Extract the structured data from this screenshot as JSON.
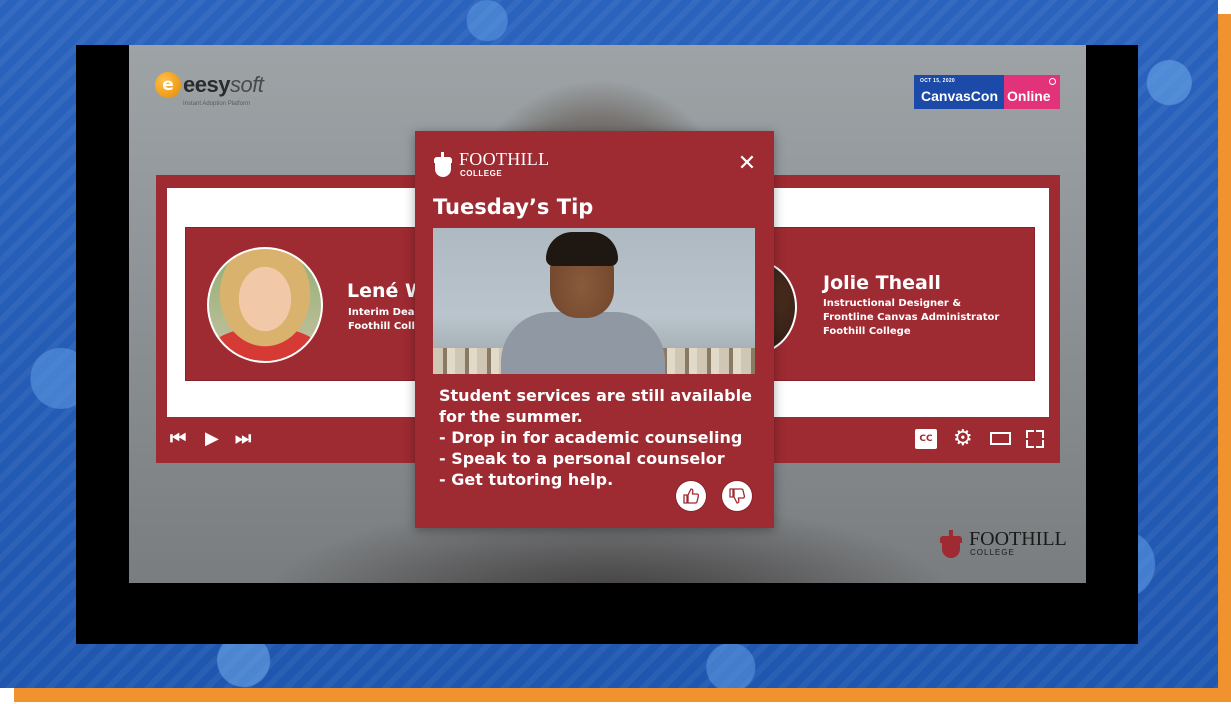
{
  "frame": {
    "accent_color": "#f0922e",
    "background_color": "#1f57b0"
  },
  "brand_top_left": {
    "badge": "e",
    "name_bold": "eesy",
    "name_light": "soft",
    "tagline": "Instant Adoption Platform"
  },
  "event_badge": {
    "date": "OCT 15, 2020",
    "name": "CanvasCon",
    "online": "Online",
    "colors": {
      "left": "#1b4aa8",
      "right": "#e2337a"
    }
  },
  "player": {
    "accent_color": "#9e2a32",
    "speaker_left": {
      "name": "Lené W",
      "role_lines": [
        "Interim Dea",
        "Foothill Coll"
      ]
    },
    "speaker_right": {
      "name": "Jolie Theall",
      "role_lines": [
        "Instructional Designer &",
        "Frontline Canvas Administrator",
        "Foothill College"
      ]
    },
    "controls": {
      "prev": "⏮",
      "play": "▶",
      "next": "⏭",
      "cc": "CC",
      "settings": "⚙"
    }
  },
  "tip": {
    "brand": "FOOTHILL",
    "brand_sub": "COLLEGE",
    "close": "✕",
    "title": "Tuesday’s Tip",
    "lines": [
      "Student services are still available",
      "for the summer.",
      "- Drop in for academic counseling",
      "- Speak to a personal counselor",
      "- Get tutoring help."
    ],
    "icons": [
      "thumbs-up-icon",
      "thumbs-down-icon"
    ]
  },
  "corner_logo": {
    "name": "FOOTHILL",
    "sub": "COLLEGE"
  }
}
